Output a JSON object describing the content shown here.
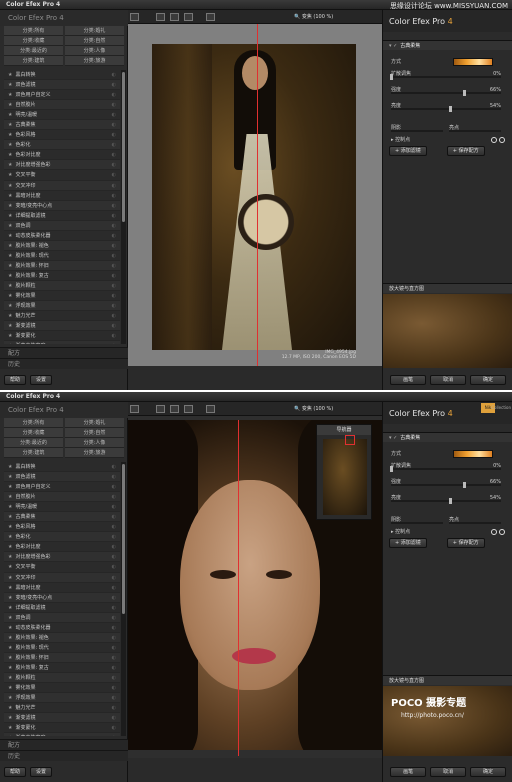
{
  "watermark": "思缘设计论坛 www.MISSYUAN.COM",
  "app": {
    "title": "Color Efex Pro 4",
    "brand_left": "Color Efex Pro 4",
    "brand_right_main": "Color Efex Pro",
    "brand_right_ver": "4",
    "nik_badge": "Nik",
    "collection": "Collection"
  },
  "categories": [
    "分类:所有",
    "分类:婚礼",
    "分类:收藏",
    "分类:自然",
    "分类:最近的",
    "分类:人像",
    "分类:建筑",
    "分类:旅游"
  ],
  "filters": [
    "黑白转换",
    "双色滤镜",
    "双色用户自定义",
    "自然胶片",
    "明亮/温暖",
    "古典柔焦",
    "色彩风格",
    "色彩化",
    "色彩对比度",
    "对比度增强色彩",
    "交叉平衡",
    "交叉冲印",
    "黑暗对比度",
    "变暗/变亮中心点",
    "详细提取滤镜",
    "双色调",
    "动态皮肤柔化器",
    "胶片效果: 褪色",
    "胶片效果: 现代",
    "胶片效果: 怀旧",
    "胶片效果: 复古",
    "胶片颗粒",
    "雾化效果",
    "浮现效果",
    "魅力光芒",
    "渐变滤镜",
    "渐变蒙化",
    "渐变中性密度"
  ],
  "sections": {
    "presets": "配方",
    "history": "历史"
  },
  "left_buttons": {
    "help": "帮助",
    "settings": "设置"
  },
  "toolbar": {
    "zoom_top": "变焦 (100 %)",
    "zoom_bottom": "变焦 (100 %)"
  },
  "caption": {
    "file": "IMG_4954.jpg",
    "info": "12.7 MP, ISO 200, Canon EOS 5D"
  },
  "navigator": {
    "title": "导航器"
  },
  "filter_panel": {
    "title": "古典柔焦",
    "method_label": "方式",
    "diffusion_label": "扩散调焦",
    "diffusion_value": "0%",
    "diffusion_frac": 0.0,
    "strength_label": "强度",
    "strength_value": "66%",
    "strength_frac": 0.66,
    "brightness_label": "亮度",
    "brightness_value": "54%",
    "brightness_frac": 0.54,
    "shadows_label": "阴影",
    "highlights_label": "亮点",
    "control_points_label": "控制点",
    "add_filter": "添加滤镜",
    "save_preset": "保存配方"
  },
  "loupe": {
    "label": "放大镜与直方图"
  },
  "poco": {
    "logo": "POCO 摄影专题",
    "url": "http://photo.poco.cn/"
  },
  "right_buttons": {
    "brush": "画笔",
    "cancel": "取消",
    "ok": "确定"
  }
}
